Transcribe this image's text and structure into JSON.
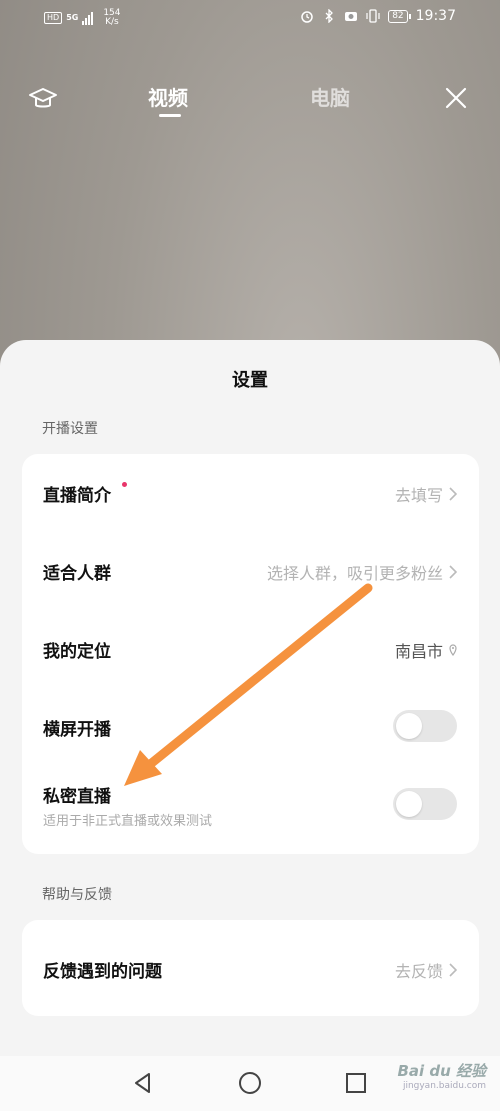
{
  "status_bar": {
    "hd": "HD",
    "network": "5G",
    "speed_value": "154",
    "speed_unit": "K/s",
    "battery": "82",
    "time": "19:37"
  },
  "top_nav": {
    "tabs": [
      {
        "label": "视频",
        "active": true
      },
      {
        "label": "电脑",
        "active": false
      }
    ],
    "left_icon": "graduation-cap-icon",
    "right_icon": "close-icon"
  },
  "sheet": {
    "title": "设置",
    "sections": [
      {
        "label": "开播设置",
        "rows": [
          {
            "label": "直播简介",
            "value": "去填写",
            "badge": true
          },
          {
            "label": "适合人群",
            "value": "选择人群，吸引更多粉丝"
          },
          {
            "label": "我的定位",
            "value": "南昌市"
          },
          {
            "label": "横屏开播",
            "toggle": false
          },
          {
            "label": "私密直播",
            "sub": "适用于非正式直播或效果测试",
            "toggle": false
          }
        ]
      },
      {
        "label": "帮助与反馈",
        "rows": [
          {
            "label": "反馈遇到的问题",
            "value": "去反馈"
          }
        ]
      }
    ]
  },
  "annotation": {
    "arrow_color": "#f5923e"
  },
  "watermark": {
    "brand": "Bai du 经验",
    "url": "jingyan.baidu.com"
  },
  "colors": {
    "accent_dot": "#e8356a",
    "sheet_bg": "#f4f4f4"
  }
}
